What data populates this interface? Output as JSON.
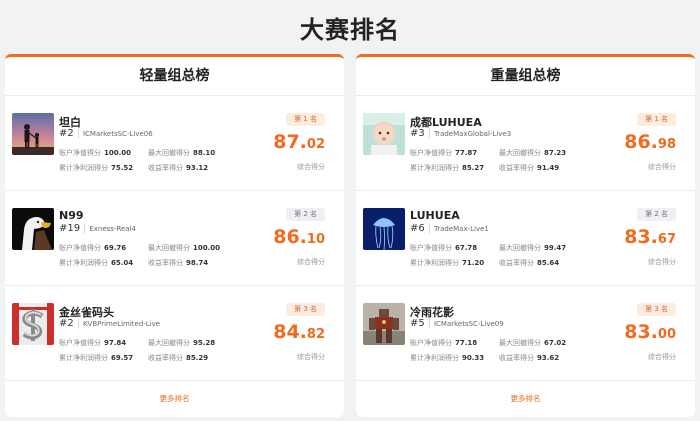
{
  "page": {
    "title": "大赛排名"
  },
  "metric_labels": {
    "equity": "账户净值得分",
    "drawdown": "最大回撤得分",
    "profit": "累计净利润得分",
    "return": "收益率得分"
  },
  "score_label": "综合得分",
  "more_label": "更多排名",
  "colors": {
    "accent": "#f26a1b",
    "gold_badge_bg": "#fdece0",
    "grey_badge_bg": "#eef0f3"
  },
  "panels": [
    {
      "title": "轻量组总榜",
      "entries": [
        {
          "name": "坦白",
          "rank": "#2",
          "account": "ICMarketsSC-Live06",
          "equity": "100.00",
          "drawdown": "88.10",
          "profit": "75.52",
          "return": "93.12",
          "badge": "第 1 名",
          "score_int": "87.",
          "score_dec": "02",
          "avatar": "sunset-family-photo"
        },
        {
          "name": "N99",
          "rank": "#19",
          "account": "Exness-Real4",
          "equity": "69.76",
          "drawdown": "100.00",
          "profit": "65.04",
          "return": "98.74",
          "badge": "第 2 名",
          "score_int": "86.",
          "score_dec": "10",
          "avatar": "eagle-photo"
        },
        {
          "name": "金丝雀码头",
          "rank": "#2",
          "account": "KVBPrimeLimited-Live",
          "equity": "97.84",
          "drawdown": "95.28",
          "profit": "69.57",
          "return": "85.29",
          "badge": "第 3 名",
          "score_int": "84.",
          "score_dec": "82",
          "avatar": "dollar-sign-photo"
        }
      ]
    },
    {
      "title": "重量组总榜",
      "entries": [
        {
          "name": "成都LUHUEA",
          "rank": "#3",
          "account": "TradeMaxGlobal-Live3",
          "equity": "77.87",
          "drawdown": "87.23",
          "profit": "85.27",
          "return": "91.49",
          "badge": "第 1 名",
          "score_int": "86.",
          "score_dec": "98",
          "avatar": "baby-photo"
        },
        {
          "name": "LUHUEA",
          "rank": "#6",
          "account": "TradeMax-Live1",
          "equity": "67.78",
          "drawdown": "99.47",
          "profit": "71.20",
          "return": "85.64",
          "badge": "第 2 名",
          "score_int": "83.",
          "score_dec": "67",
          "avatar": "jellyfish-photo"
        },
        {
          "name": "冷雨花影",
          "rank": "#5",
          "account": "ICMarketsSC-Live09",
          "equity": "77.18",
          "drawdown": "67.02",
          "profit": "90.33",
          "return": "93.62",
          "badge": "第 3 名",
          "score_int": "83.",
          "score_dec": "00",
          "avatar": "robot-photo"
        }
      ]
    }
  ]
}
